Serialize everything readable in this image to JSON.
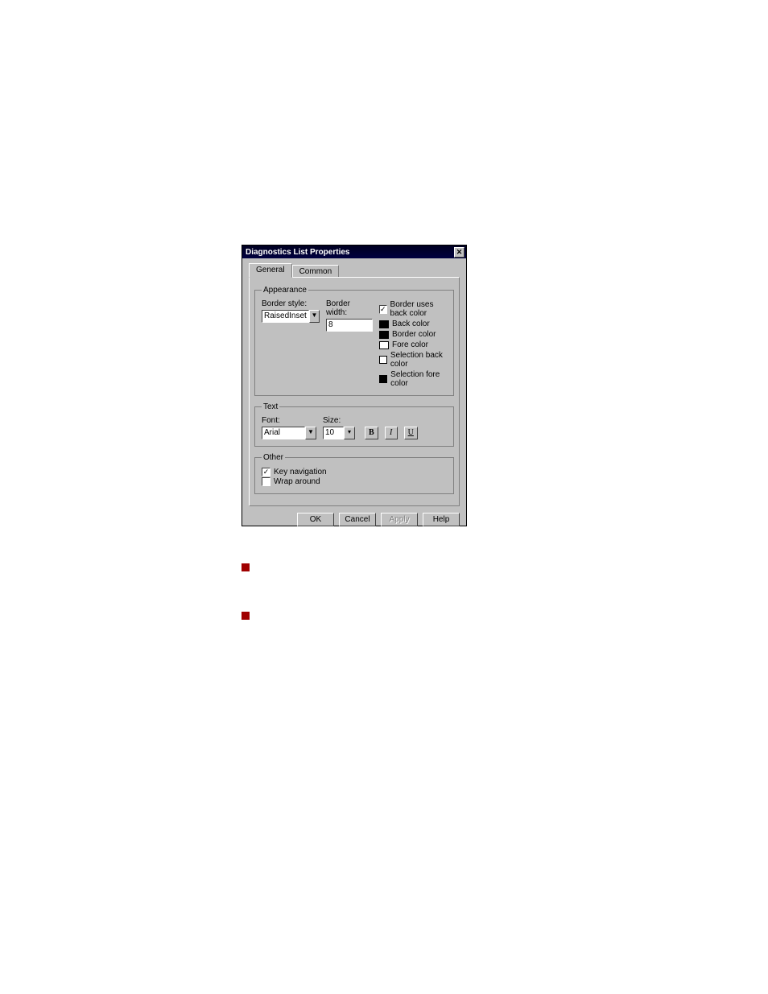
{
  "dialog": {
    "title": "Diagnostics List Properties",
    "tabs": {
      "general": "General",
      "common": "Common"
    },
    "groups": {
      "appearance": {
        "legend": "Appearance",
        "border_style_label": "Border style:",
        "border_style_value": "RaisedInset",
        "border_width_label": "Border width:",
        "border_width_value": "8",
        "border_uses_back_color": {
          "label": "Border uses back color",
          "checked": true
        },
        "colors": {
          "back": {
            "label": "Back color",
            "hex": "#000000"
          },
          "border": {
            "label": "Border color",
            "hex": "#000000"
          },
          "fore": {
            "label": "Fore color",
            "hex": "#ffffff"
          },
          "selection_back": {
            "label": "Selection back color",
            "hex": "#ffffff"
          },
          "selection_fore": {
            "label": "Selection fore color",
            "hex": "#000000"
          }
        }
      },
      "text": {
        "legend": "Text",
        "font_label": "Font:",
        "font_value": "Arial",
        "size_label": "Size:",
        "size_value": "10",
        "bold_glyph": "B",
        "italic_glyph": "I",
        "underline_glyph": "U"
      },
      "other": {
        "legend": "Other",
        "key_navigation": {
          "label": "Key navigation",
          "checked": true
        },
        "wrap_around": {
          "label": "Wrap around",
          "checked": false
        }
      }
    },
    "buttons": {
      "ok": "OK",
      "cancel": "Cancel",
      "apply": "Apply",
      "help": "Help"
    }
  }
}
